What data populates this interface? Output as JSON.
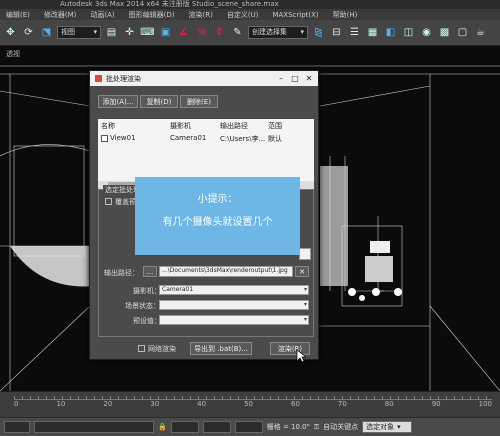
{
  "window": {
    "title": "Autodesk 3ds Max  2014 x64    未注册版      Studio_scene_share.max"
  },
  "menu": [
    "编辑(E)",
    "修改器(M)",
    "动画(A)",
    "图形编辑器(D)",
    "渲染(R)",
    "自定义(U)",
    "MAXScript(X)",
    "帮助(H)"
  ],
  "toolbar": {
    "view_select": "视图",
    "named_selection": "创建选择集"
  },
  "viewport": {
    "label": "透视"
  },
  "dialog": {
    "title": "批处理渲染",
    "add_button": "添加(A)...",
    "copy_button": "复制(D)",
    "delete_button": "删除(E)",
    "columns": [
      "名称",
      "摄影机",
      "输出路径",
      "范围"
    ],
    "rows": [
      {
        "name": "View01",
        "camera": "Camera01",
        "path": "C:\\Users\\李...",
        "range": "默认"
      }
    ],
    "section_label": "选定批处理渲染参数",
    "override_checkbox": "覆盖预设",
    "output_path_label": "输出路径：",
    "output_path_browse": "...",
    "output_path_value": "...\\Documents\\3dsMax\\renderoutput\\1.jpg",
    "camera_label": "摄影机：",
    "camera_value": "Camera01",
    "scene_state_label": "场景状态：",
    "preset_label": "预设值：",
    "net_render": "网络渲染",
    "export_button": "导出到 .bat(B)...",
    "render_button": "渲染(R)"
  },
  "tip": {
    "line1": "小提示：",
    "line2": "有几个摄像头就设置几个"
  },
  "timeline": {
    "ticks": [
      "0",
      "10",
      "20",
      "30",
      "40",
      "50",
      "60",
      "70",
      "80",
      "90",
      "100"
    ]
  },
  "status": {
    "grid": "栅格 = 10.0\"",
    "autokey": "自动关键点",
    "selected": "选定对象"
  }
}
